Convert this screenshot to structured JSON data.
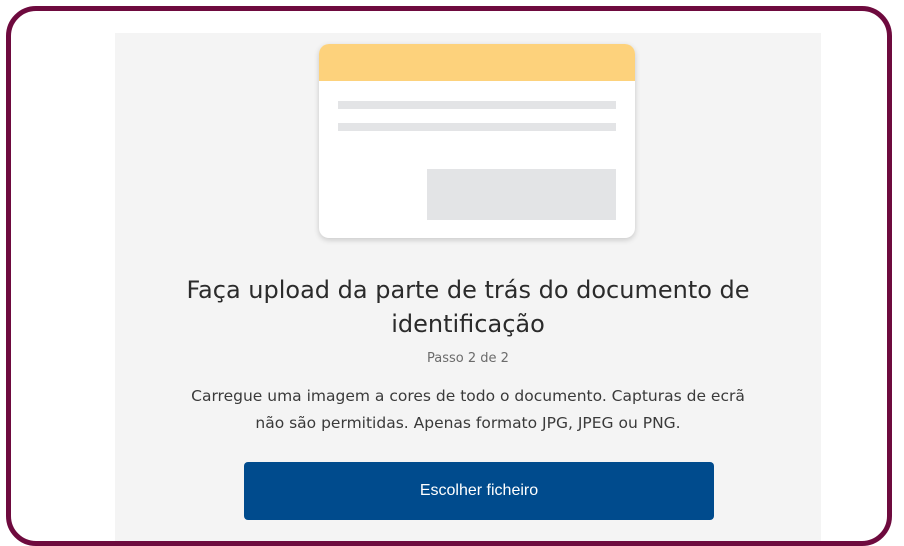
{
  "upload": {
    "title": "Faça upload da parte de trás do documento de identificação",
    "step": "Passo 2 de 2",
    "description": "Carregue uma imagem a cores de todo o documento. Capturas de ecrã não são permitidas. Apenas formato JPG, JPEG ou PNG.",
    "button_label": "Escolher ficheiro"
  },
  "colors": {
    "frame_border": "#6e0a3e",
    "panel_background": "#f4f4f4",
    "document_header": "#fdd27c",
    "button_background": "#004b8d"
  },
  "icons": {
    "illustration": "id-card-back-icon"
  }
}
